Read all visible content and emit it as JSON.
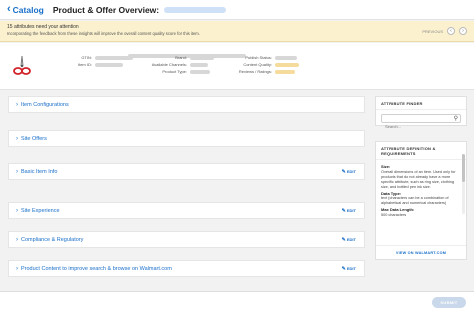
{
  "header": {
    "back_label": "Catalog",
    "title": "Product & Offer Overview:"
  },
  "notice": {
    "title": "15 attributes need your attention",
    "subtitle": "Incorporating the feedback from these insights will improve the overall content quality score for this item.",
    "previous_label": "PREVIOUS"
  },
  "product": {
    "labels": {
      "gtin": "GTIN:",
      "item_id": "Item ID:",
      "brand": "Brand:",
      "available_channels": "Available Channels:",
      "product_type": "Product Type:",
      "publish_status": "Publish Status:",
      "content_quality": "Content Quality:",
      "reviews_ratings": "Reviews / Ratings:"
    }
  },
  "sections": [
    {
      "label": "Item Configurations"
    },
    {
      "label": "Site Offers"
    },
    {
      "label": "Basic Item Info",
      "edit": "EDIT"
    },
    {
      "label": "Site Experience",
      "edit": "EDIT"
    },
    {
      "label": "Compliance & Regulatory",
      "edit": "EDIT"
    },
    {
      "label": "Product Content to improve search & browse on Walmart.com",
      "edit": "EDIT"
    }
  ],
  "attribute_finder": {
    "title": "ATTRIBUTE FINDER",
    "search_placeholder": "Search..."
  },
  "definition": {
    "title": "ATTRIBUTE DEFINITION & REQUIREMENTS",
    "size_label": "Size:",
    "size_text": "Overall dimensions of an item. Used only for products that do not already have a more specific attribute, such as ring size, clothing size, and bottled pen ink size.",
    "data_type_label": "Data Type:",
    "data_type_text": "text (characters can be a combination of alphabetical and numerical characters)",
    "max_length_label": "Max Data Length:",
    "max_length_text": "500 characters",
    "link_label": "VIEW ON WALMART.COM"
  },
  "footer": {
    "submit_label": "SUBMIT"
  },
  "colors": {
    "accent": "#1a6fc9",
    "notice_bg": "#fbf1ce",
    "submit_disabled": "#c9d8ea"
  }
}
